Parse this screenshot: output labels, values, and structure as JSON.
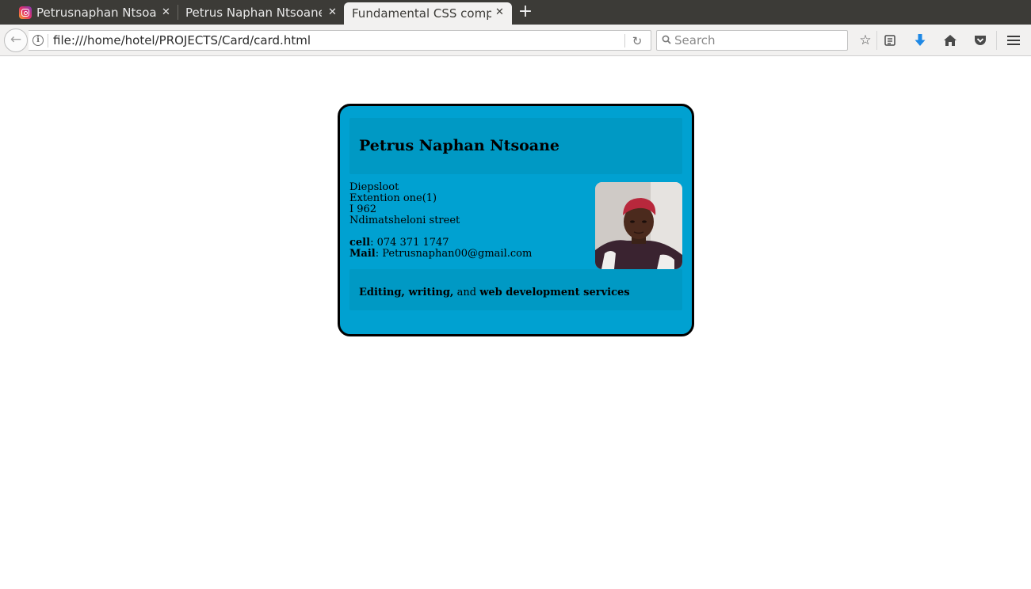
{
  "browser": {
    "tabs": [
      {
        "title": "Petrusnaphan Ntsoane",
        "favicon": "instagram-icon",
        "active": false
      },
      {
        "title": "Petrus Naphan Ntsoane",
        "active": false
      },
      {
        "title": "Fundamental CSS comprehension",
        "active": true
      }
    ],
    "url": "file:///home/hotel/PROJECTS/Card/card.html",
    "search_placeholder": "Search"
  },
  "card": {
    "name": "Petrus Naphan Ntsoane",
    "address": [
      "Diepsloot",
      "Extention one(1)",
      "I 962",
      "Ndimatsheloni street"
    ],
    "cell_label": "cell",
    "cell_value": ": 074 371 1747",
    "mail_label": "Mail",
    "mail_value": ": Petrusnaphan00@gmail.com",
    "services": {
      "part1": "Editing, writing,",
      "part2": " and ",
      "part3": "web development services"
    },
    "colors": {
      "background": "#00a1d1",
      "panel": "#0099c4",
      "border": "#000000"
    }
  }
}
